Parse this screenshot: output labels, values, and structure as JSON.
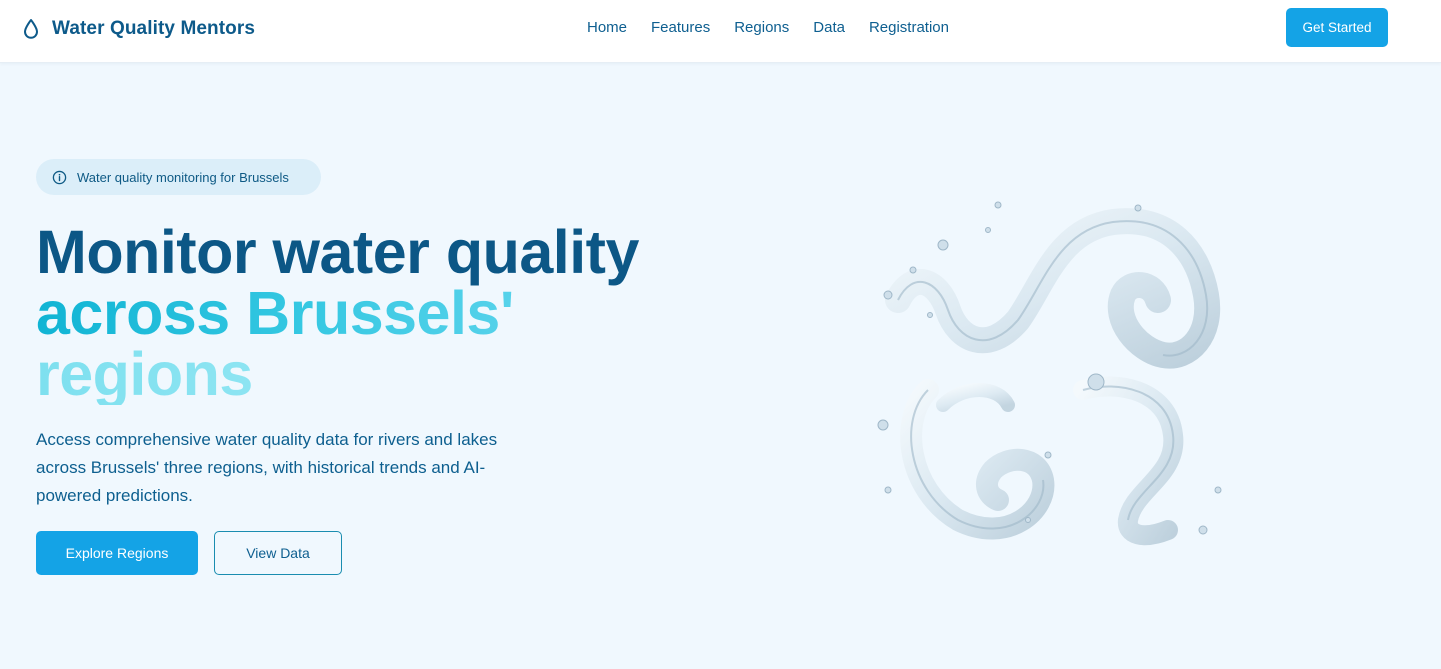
{
  "header": {
    "brand": "Water Quality Mentors",
    "nav": [
      {
        "label": "Home"
      },
      {
        "label": "Features"
      },
      {
        "label": "Regions"
      },
      {
        "label": "Data"
      },
      {
        "label": "Registration"
      }
    ],
    "cta": "Get Started"
  },
  "hero": {
    "badge": "Water quality monitoring for Brussels",
    "headline_line1": "Monitor water quality",
    "headline_line2": "across Brussels'",
    "headline_line3": "regions",
    "description": "Access comprehensive water quality data for rivers and lakes across Brussels' three regions, with historical trends and AI-powered predictions.",
    "primary_button": "Explore Regions",
    "secondary_button": "View Data"
  },
  "icons": {
    "logo": "water-drop-icon",
    "badge": "info-icon"
  },
  "colors": {
    "brand": "#0d5a8a",
    "accent": "#14a3e6",
    "background": "#f0f8fe",
    "badge_bg": "#dbeef9"
  }
}
